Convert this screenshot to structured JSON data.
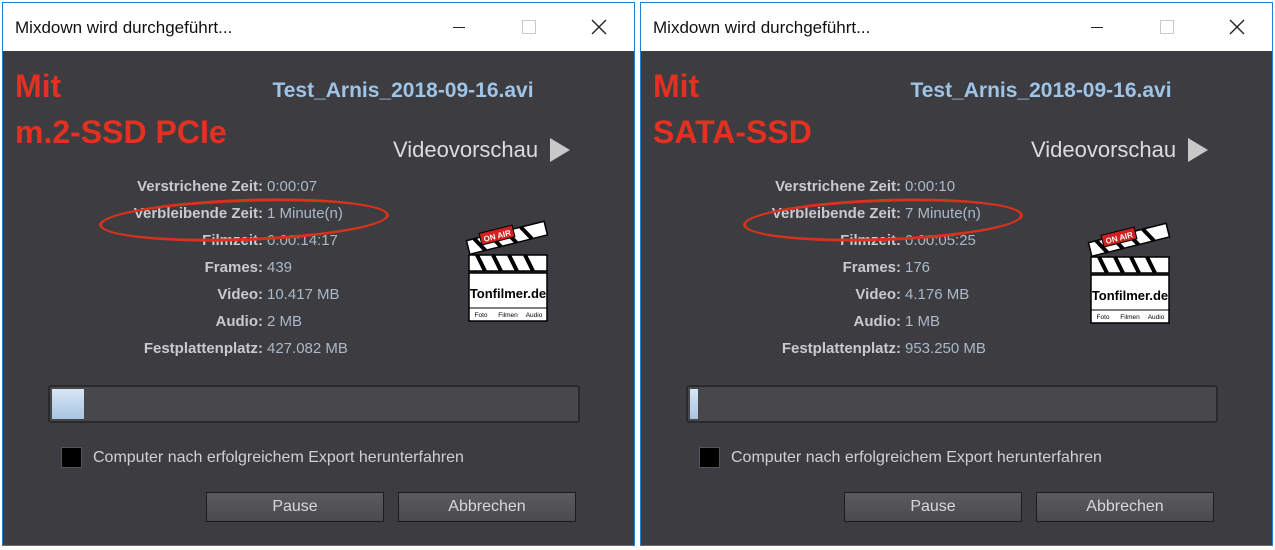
{
  "windows": [
    {
      "title": "Mixdown wird durchgeführt...",
      "overlay_line1": "Mit",
      "overlay_line2": "m.2-SSD PCIe",
      "filename": "Test_Arnis_2018-09-16.avi",
      "preview_label": "Videovorschau",
      "stats": [
        {
          "label": "Verstrichene Zeit:",
          "value": "0:00:07"
        },
        {
          "label": "Verbleibende Zeit:",
          "value": "1 Minute(n)"
        },
        {
          "label": "Filmzeit:",
          "value": "0:00:14:17"
        },
        {
          "label": "Frames:",
          "value": "439"
        },
        {
          "label": "Video:",
          "value": "10.417 MB"
        },
        {
          "label": "Audio:",
          "value": "2 MB"
        },
        {
          "label": "Festplattenplatz:",
          "value": "427.082 MB"
        }
      ],
      "progress_percent": 6,
      "checkbox_label": "Computer nach erfolgreichem Export herunterfahren",
      "pause_label": "Pause",
      "cancel_label": "Abbrechen"
    },
    {
      "title": "Mixdown wird durchgeführt...",
      "overlay_line1": "Mit",
      "overlay_line2": "SATA-SSD",
      "filename": "Test_Arnis_2018-09-16.avi",
      "preview_label": "Videovorschau",
      "stats": [
        {
          "label": "Verstrichene Zeit:",
          "value": "0:00:10"
        },
        {
          "label": "Verbleibende Zeit:",
          "value": "7 Minute(n)"
        },
        {
          "label": "Filmzeit:",
          "value": "0:00:05:25"
        },
        {
          "label": "Frames:",
          "value": "176"
        },
        {
          "label": "Video:",
          "value": "4.176 MB"
        },
        {
          "label": "Audio:",
          "value": "1 MB"
        },
        {
          "label": "Festplattenplatz:",
          "value": "953.250 MB"
        }
      ],
      "progress_percent": 1.5,
      "checkbox_label": "Computer nach erfolgreichem Export herunterfahren",
      "pause_label": "Pause",
      "cancel_label": "Abbrechen"
    }
  ],
  "logo": {
    "badge": "ON AIR",
    "brand": "Tonfilmer.de",
    "tags": [
      "Foto",
      "Filmen",
      "Audio"
    ]
  },
  "colors": {
    "dialog_bg": "#3d3d41",
    "accent_red": "#e33020",
    "filename_blue": "#9ec4e8",
    "window_border": "#1f7fd1"
  }
}
